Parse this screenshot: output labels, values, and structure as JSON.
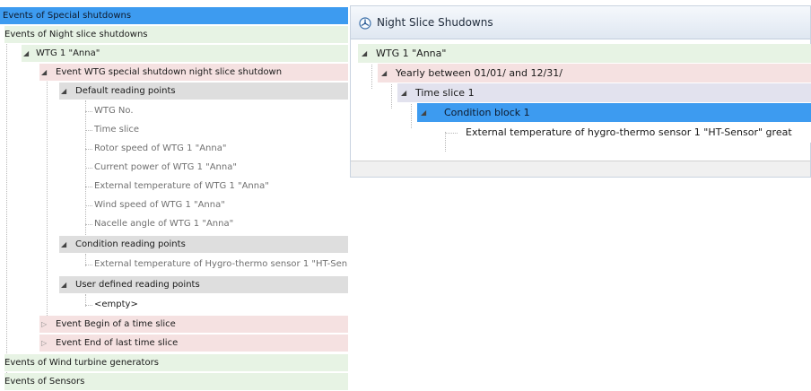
{
  "left_tree": {
    "events_special": "Events of Special shutdowns",
    "events_night": "Events of Night slice shutdowns",
    "wtg": "WTG 1 \"Anna\"",
    "event_wtg": "Event WTG special shutdown night slice shutdown",
    "default_points": {
      "label": "Default reading points",
      "items": [
        "WTG No.",
        "Time slice",
        "Rotor speed of WTG 1 \"Anna\"",
        "Current power of WTG 1 \"Anna\"",
        "External temperature of WTG 1 \"Anna\"",
        "Wind speed of WTG 1 \"Anna\"",
        "Nacelle angle of WTG 1 \"Anna\""
      ]
    },
    "condition_points": {
      "label": "Condition reading points",
      "item": "External temperature of Hygro-thermo sensor 1 \"HT-Sen"
    },
    "user_points": {
      "label": "User defined reading points",
      "item": "<empty>"
    },
    "event_begin": "Event Begin of a time slice",
    "event_end": "Event End of last time slice",
    "events_wind": "Events of Wind turbine generators",
    "events_sensors": "Events of Sensors"
  },
  "right_window": {
    "title": "Night Slice Shudowns",
    "icon": "wind-turbine-icon",
    "tree": {
      "wtg": "WTG 1 \"Anna\"",
      "yearly": "Yearly between 01/01/ and 12/31/",
      "time_slice": "Time slice 1",
      "condition_block": "Condition block 1",
      "external_temp": "External temperature of hygro-thermo sensor 1 \"HT-Sensor\" great"
    }
  },
  "colors": {
    "selected": "#3d9bf0",
    "green_row": "#e7f3e4",
    "pink_row": "#f5e1e1",
    "gray_row": "#dedede",
    "lavender_row": "#e2e2ee"
  }
}
